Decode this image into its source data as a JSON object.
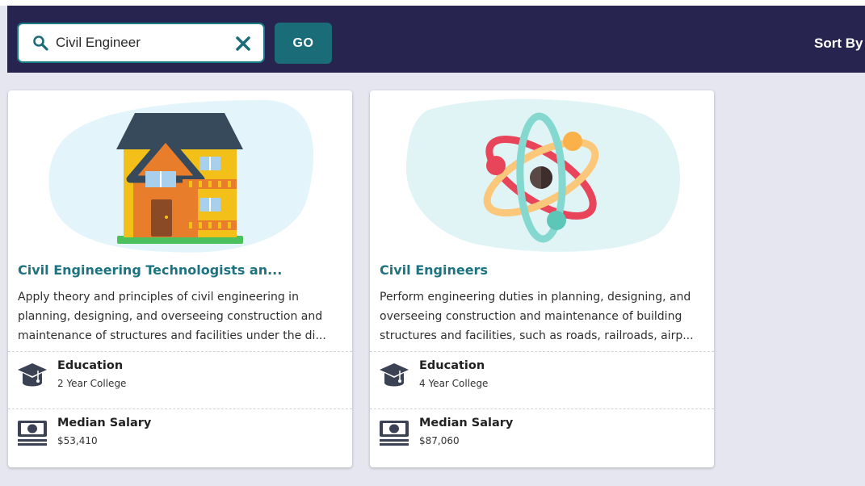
{
  "search": {
    "value": "Civil Engineer",
    "go_label": "GO"
  },
  "sort": {
    "label": "Sort By"
  },
  "colors": {
    "header_bg": "#272550",
    "accent": "#1d7380",
    "page_bg": "#e6e6f0"
  },
  "cards": [
    {
      "title": "Civil Engineering Technologists an...",
      "description": "Apply theory and principles of civil engineering in planning, designing, and overseeing construction and maintenance of structures and facilities under the di...",
      "illustration": "house-icon",
      "education_label": "Education",
      "education_value": "2 Year College",
      "salary_label": "Median Salary",
      "salary_value": "$53,410"
    },
    {
      "title": "Civil Engineers",
      "description": "Perform engineering duties in planning, designing, and overseeing construction and maintenance of building structures and facilities, such as roads, railroads, airp...",
      "illustration": "atom-icon",
      "education_label": "Education",
      "education_value": "4 Year College",
      "salary_label": "Median Salary",
      "salary_value": "$87,060"
    }
  ]
}
